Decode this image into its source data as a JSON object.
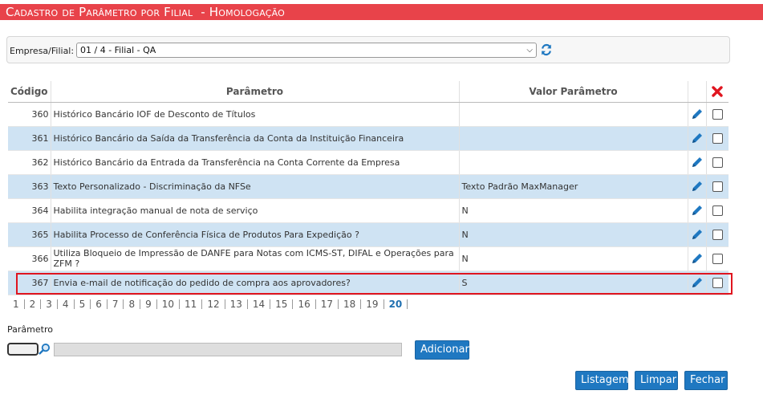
{
  "title": "Cadastro de Parâmetro por Filial  - Homologação",
  "filter": {
    "label": "Empresa/Filial:",
    "selected": "01 / 4 - Filial - QA"
  },
  "table": {
    "headers": {
      "codigo": "Código",
      "parametro": "Parâmetro",
      "valor": "Valor Parâmetro"
    },
    "rows": [
      {
        "codigo": "360",
        "parametro": "Histórico Bancário IOF de Desconto de Títulos",
        "valor": ""
      },
      {
        "codigo": "361",
        "parametro": "Histórico Bancário da Saída da Transferência da Conta da Instituição Financeira",
        "valor": ""
      },
      {
        "codigo": "362",
        "parametro": "Histórico Bancário da Entrada da Transferência na Conta Corrente da Empresa",
        "valor": ""
      },
      {
        "codigo": "363",
        "parametro": "Texto Personalizado - Discriminação da NFSe",
        "valor": "Texto Padrão MaxManager"
      },
      {
        "codigo": "364",
        "parametro": "Habilita integração manual de nota de serviço",
        "valor": "N"
      },
      {
        "codigo": "365",
        "parametro": "Habilita Processo de Conferência Física de Produtos Para Expedição ?",
        "valor": "N"
      },
      {
        "codigo": "366",
        "parametro": "Utiliza Bloqueio de Impressão de DANFE para Notas com ICMS-ST, DIFAL e Operações para ZFM ?",
        "valor": "N"
      },
      {
        "codigo": "367",
        "parametro": "Envia e-mail de notificação do pedido de compra aos aprovadores?",
        "valor": "S"
      }
    ]
  },
  "pager": {
    "pages": [
      "1",
      "2",
      "3",
      "4",
      "5",
      "6",
      "7",
      "8",
      "9",
      "10",
      "11",
      "12",
      "13",
      "14",
      "15",
      "16",
      "17",
      "18",
      "19"
    ],
    "current": "20"
  },
  "form": {
    "label": "Parâmetro",
    "add_label": "Adicionar"
  },
  "actions": {
    "list_label": "Listagem",
    "clear_label": "Limpar",
    "close_label": "Fechar"
  },
  "colors": {
    "title_bg": "#e8434a",
    "row_alt": "#cfe3f3",
    "button": "#1f78c1",
    "highlight": "#e0151f"
  },
  "icons": {
    "refresh": "refresh-icon",
    "edit": "pencil-icon",
    "delete": "delete-x-icon",
    "search": "magnifier-icon"
  }
}
